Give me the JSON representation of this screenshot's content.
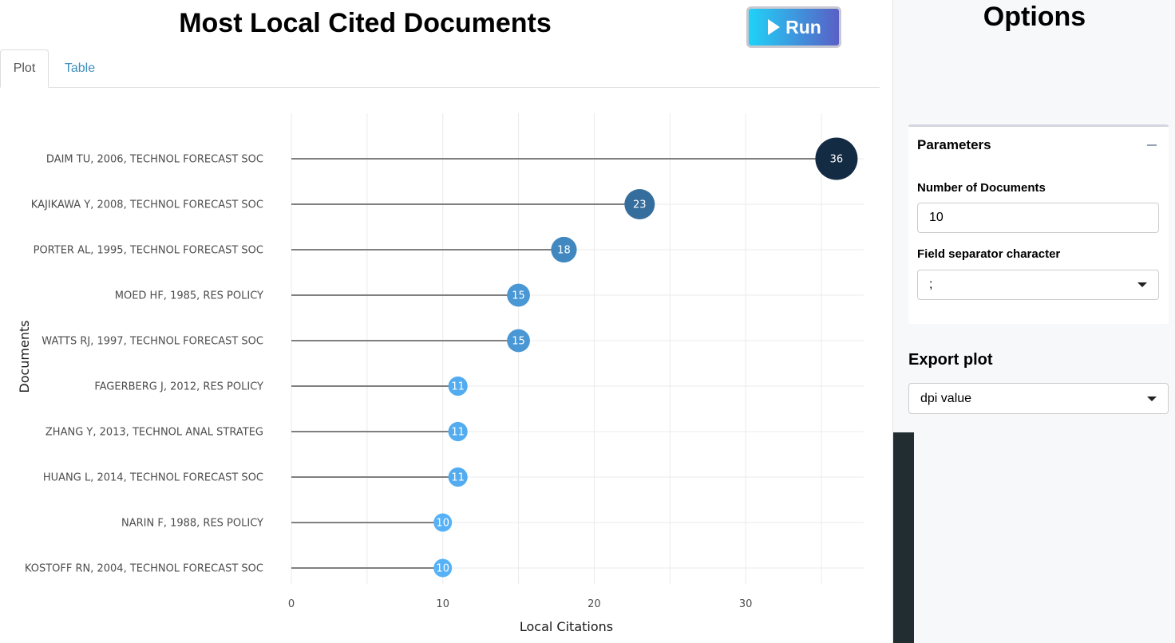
{
  "header": {
    "title": "Most Local Cited Documents",
    "run_label": "Run"
  },
  "tabs": [
    {
      "label": "Plot",
      "active": true
    },
    {
      "label": "Table",
      "active": false
    }
  ],
  "sidebar": {
    "title": "Options",
    "parameters": {
      "header": "Parameters",
      "num_docs_label": "Number of Documents",
      "num_docs_value": "10",
      "separator_label": "Field separator character",
      "separator_value": ";"
    },
    "export": {
      "title": "Export plot",
      "dpi_placeholder": "dpi value"
    }
  },
  "colors": {
    "run_gradient_start": "#1fd2f7",
    "run_gradient_end": "#5a5fc6",
    "bubble_dark": "#132b43",
    "bubble_light": "#56b1f7"
  },
  "chart_data": {
    "type": "lollipop",
    "xlabel": "Local Citations",
    "ylabel": "Documents",
    "xlim": [
      0,
      38
    ],
    "xticks": [
      0,
      10,
      20,
      30
    ],
    "grid": true,
    "categories": [
      "DAIM TU, 2006, TECHNOL FORECAST SOC",
      "KAJIKAWA Y, 2008, TECHNOL FORECAST SOC",
      "PORTER AL, 1995, TECHNOL FORECAST SOC",
      "MOED HF, 1985, RES POLICY",
      "WATTS RJ, 1997, TECHNOL FORECAST SOC",
      "FAGERBERG J, 2012, RES POLICY",
      "ZHANG Y, 2013, TECHNOL ANAL STRATEG",
      "HUANG L, 2014, TECHNOL FORECAST SOC",
      "NARIN F, 1988, RES POLICY",
      "KOSTOFF RN, 2004, TECHNOL FORECAST SOC"
    ],
    "values": [
      36,
      23,
      18,
      15,
      15,
      11,
      11,
      11,
      10,
      10
    ]
  }
}
